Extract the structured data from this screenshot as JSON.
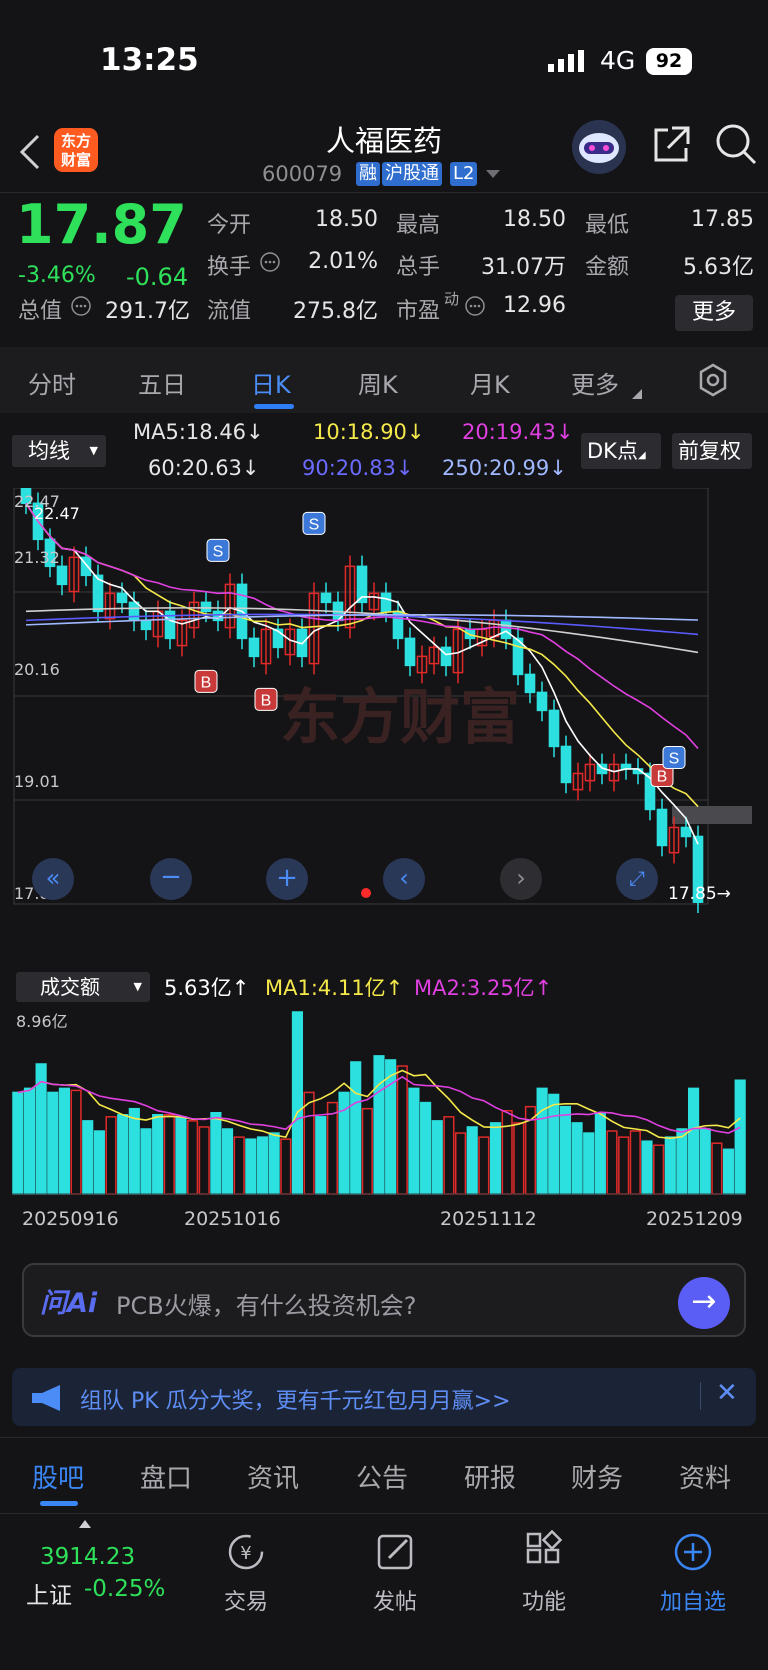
{
  "status": {
    "time": "13:25",
    "network": "4G",
    "battery": "92"
  },
  "header": {
    "logo_line1": "东方",
    "logo_line2": "财富",
    "name": "人福医药",
    "code": "600079",
    "tags": [
      "融",
      "沪股通",
      "L2"
    ]
  },
  "quote": {
    "price": "17.87",
    "change_pct": "-3.46%",
    "change": "-0.64",
    "fields": [
      {
        "label": "今开",
        "value": "18.50"
      },
      {
        "label": "最高",
        "value": "18.50"
      },
      {
        "label": "最低",
        "value": "17.85"
      },
      {
        "label": "换手",
        "value": "2.01%"
      },
      {
        "label": "总手",
        "value": "31.07万"
      },
      {
        "label": "金额",
        "value": "5.63亿"
      },
      {
        "label": "总值",
        "value": "291.7亿"
      },
      {
        "label": "流值",
        "value": "275.8亿"
      },
      {
        "label": "市盈",
        "value": "12.96"
      }
    ],
    "pe_superscript": "动",
    "more": "更多"
  },
  "period_tabs": [
    "分时",
    "五日",
    "日K",
    "周K",
    "月K",
    "更多"
  ],
  "ma": {
    "select": "均线",
    "items": [
      {
        "text": "MA5:18.46↓",
        "color": "#ffffff"
      },
      {
        "text": "10:18.90↓",
        "color": "#f5e84a"
      },
      {
        "text": "20:19.43↓",
        "color": "#e040e0"
      },
      {
        "text": "60:20.63↓",
        "color": "#ffffff"
      },
      {
        "text": "90:20.83↓",
        "color": "#5b5bff"
      },
      {
        "text": "250:20.99↓",
        "color": "#9fb8ff"
      }
    ],
    "dk": "DK点",
    "adj": "前复权"
  },
  "kline": {
    "y_labels": [
      "22.47",
      "21.32",
      "20.16",
      "19.01",
      "17.85"
    ],
    "max_label": "22.47",
    "last_label": "17.85→",
    "watermark": "东方财富"
  },
  "volume": {
    "select": "成交额",
    "items": [
      {
        "text": "5.63亿↑",
        "color": "#ffffff"
      },
      {
        "text": "MA1:4.11亿↑",
        "color": "#f5e84a"
      },
      {
        "text": "MA2:3.25亿↑",
        "color": "#e040e0"
      }
    ],
    "max_label": "8.96亿",
    "dates": [
      "20250916",
      "20251016",
      "20251112",
      "20251209"
    ]
  },
  "chart_data": {
    "type": "bar",
    "title": "",
    "xlabel": "",
    "ylabel": "",
    "ylim": [
      17.85,
      22.47
    ],
    "x_ticks": [
      "20250916",
      "20251016",
      "20251112",
      "20251209"
    ],
    "candles_close": [
      22.3,
      21.9,
      21.6,
      21.4,
      21.7,
      21.5,
      21.1,
      21.3,
      21.2,
      21.0,
      20.9,
      21.1,
      20.8,
      21.0,
      21.2,
      21.1,
      21.0,
      21.4,
      20.8,
      20.6,
      20.9,
      20.7,
      20.9,
      20.6,
      21.3,
      21.2,
      21.0,
      21.6,
      21.2,
      21.3,
      21.1,
      20.8,
      20.5,
      20.6,
      20.7,
      20.5,
      20.9,
      20.8,
      20.9,
      21.0,
      20.8,
      20.4,
      20.2,
      20.0,
      19.6,
      19.2,
      19.3,
      19.4,
      19.3,
      19.4,
      19.35,
      19.3,
      18.9,
      18.5,
      18.7,
      18.6,
      17.87
    ],
    "candles_up": [
      false,
      false,
      false,
      false,
      true,
      false,
      false,
      true,
      false,
      false,
      false,
      true,
      false,
      true,
      true,
      false,
      false,
      true,
      false,
      false,
      true,
      false,
      true,
      false,
      true,
      false,
      false,
      true,
      false,
      true,
      false,
      false,
      false,
      true,
      true,
      false,
      true,
      false,
      true,
      true,
      false,
      false,
      false,
      false,
      false,
      false,
      true,
      true,
      false,
      true,
      false,
      false,
      false,
      false,
      true,
      false,
      false
    ],
    "volume_values": [
      5.0,
      5.2,
      6.4,
      5.0,
      5.2,
      5.1,
      3.6,
      3.1,
      3.8,
      3.9,
      4.2,
      3.2,
      3.9,
      3.9,
      3.8,
      3.6,
      3.3,
      4.0,
      3.2,
      2.8,
      2.7,
      2.8,
      3.0,
      2.7,
      8.96,
      5.0,
      3.8,
      4.5,
      5.0,
      6.5,
      4.2,
      6.8,
      6.6,
      6.3,
      5.2,
      4.5,
      3.6,
      3.8,
      3.0,
      3.3,
      2.8,
      3.5,
      4.1,
      3.5,
      4.3,
      5.2,
      4.9,
      4.3,
      3.5,
      3.0,
      4.0,
      3.1,
      2.8,
      3.1,
      2.6,
      2.4,
      2.8,
      3.2,
      5.2,
      3.2,
      2.5,
      2.2,
      5.6
    ],
    "series": [
      {
        "name": "MA5",
        "values": [
          18.46
        ]
      },
      {
        "name": "10",
        "values": [
          18.9
        ]
      },
      {
        "name": "20",
        "values": [
          19.43
        ]
      },
      {
        "name": "60",
        "values": [
          20.63
        ]
      },
      {
        "name": "90",
        "values": [
          20.83
        ]
      },
      {
        "name": "250",
        "values": [
          20.99
        ]
      }
    ]
  },
  "ai": {
    "logo": "问Ai",
    "prompt": "PCB火爆，有什么投资机会?"
  },
  "banner": {
    "text": "组队 PK 瓜分大奖，更有千元红包月月赢>>"
  },
  "bottom_tabs": [
    "股吧",
    "盘口",
    "资讯",
    "公告",
    "研报",
    "财务",
    "资料"
  ],
  "toolbar": {
    "index_value": "3914.23",
    "index_name": "上证",
    "index_change": "-0.25%",
    "items": [
      "交易",
      "发帖",
      "功能",
      "加自选"
    ]
  }
}
